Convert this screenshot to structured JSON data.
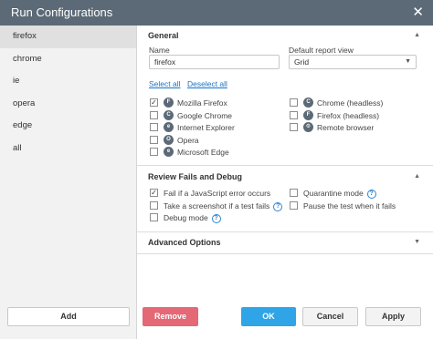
{
  "window": {
    "title": "Run Configurations",
    "close_glyph": "✕"
  },
  "sidebar": {
    "items": [
      {
        "label": "firefox",
        "active": true
      },
      {
        "label": "chrome"
      },
      {
        "label": "ie"
      },
      {
        "label": "opera"
      },
      {
        "label": "edge"
      },
      {
        "label": "all"
      }
    ],
    "add_label": "Add"
  },
  "general": {
    "header": "General",
    "name_label": "Name",
    "name_value": "firefox",
    "report_label": "Default report view",
    "report_value": "Grid",
    "select_all": "Select all",
    "deselect_all": "Deselect all",
    "browsers_left": [
      {
        "label": "Mozilla Firefox",
        "checked": true,
        "icon": "firefox-icon",
        "glyph": "F"
      },
      {
        "label": "Google Chrome",
        "checked": false,
        "icon": "chrome-icon",
        "glyph": "C"
      },
      {
        "label": "Internet Explorer",
        "checked": false,
        "icon": "ie-icon",
        "glyph": "e"
      },
      {
        "label": "Opera",
        "checked": false,
        "icon": "opera-icon",
        "glyph": "O"
      },
      {
        "label": "Microsoft Edge",
        "checked": false,
        "icon": "edge-icon",
        "glyph": "e"
      }
    ],
    "browsers_right": [
      {
        "label": "Chrome (headless)",
        "checked": false,
        "icon": "chrome-icon",
        "glyph": "C"
      },
      {
        "label": "Firefox (headless)",
        "checked": false,
        "icon": "firefox-icon",
        "glyph": "F"
      },
      {
        "label": "Remote browser",
        "checked": false,
        "icon": "remote-browser-icon",
        "glyph": "⚙"
      }
    ]
  },
  "review": {
    "header": "Review Fails and Debug",
    "opt1": "Fail if a JavaScript error occurs",
    "opt2": "Take a screenshot if a test fails",
    "opt3": "Debug mode",
    "opt4": "Quarantine mode",
    "opt5": "Pause the test when it fails",
    "help_glyph": "?"
  },
  "advanced": {
    "header": "Advanced Options"
  },
  "chevrons": {
    "up": "▲",
    "down": "▼"
  },
  "footer": {
    "remove": "Remove",
    "ok": "OK",
    "cancel": "Cancel",
    "apply": "Apply"
  },
  "colors": {
    "titlebar": "#5c6a77",
    "accent_blue": "#2fa4e7",
    "remove_red": "#e46875",
    "link": "#1a73c8"
  }
}
